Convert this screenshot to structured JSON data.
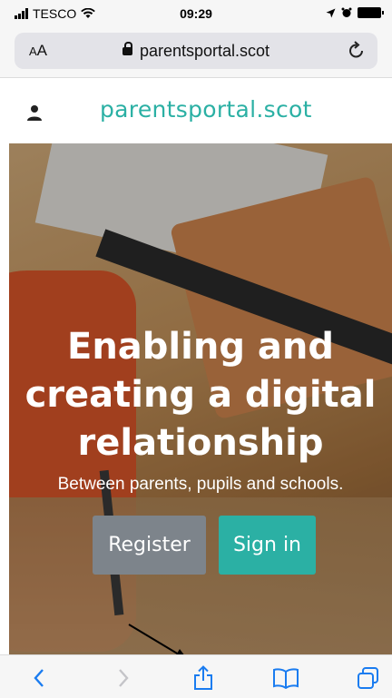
{
  "status_bar": {
    "carrier": "TESCO",
    "time": "09:29"
  },
  "browser": {
    "text_size_label_small": "A",
    "text_size_label_large": "A",
    "url": "parentsportal.scot",
    "icons": [
      "lock-icon",
      "reload-icon",
      "back-icon",
      "forward-icon",
      "share-icon",
      "bookmarks-icon",
      "tabs-icon"
    ],
    "accent_color": "#1a7cf0"
  },
  "site": {
    "brand": "parentsportal.scot",
    "brand_color": "#2bb0a4",
    "hero": {
      "title_line1": "Enabling and",
      "title_line2": "creating a digital",
      "title_line3": "relationship",
      "subtitle": "Between parents, pupils and schools."
    },
    "register_label": "Register",
    "signin_label": "Sign in"
  }
}
